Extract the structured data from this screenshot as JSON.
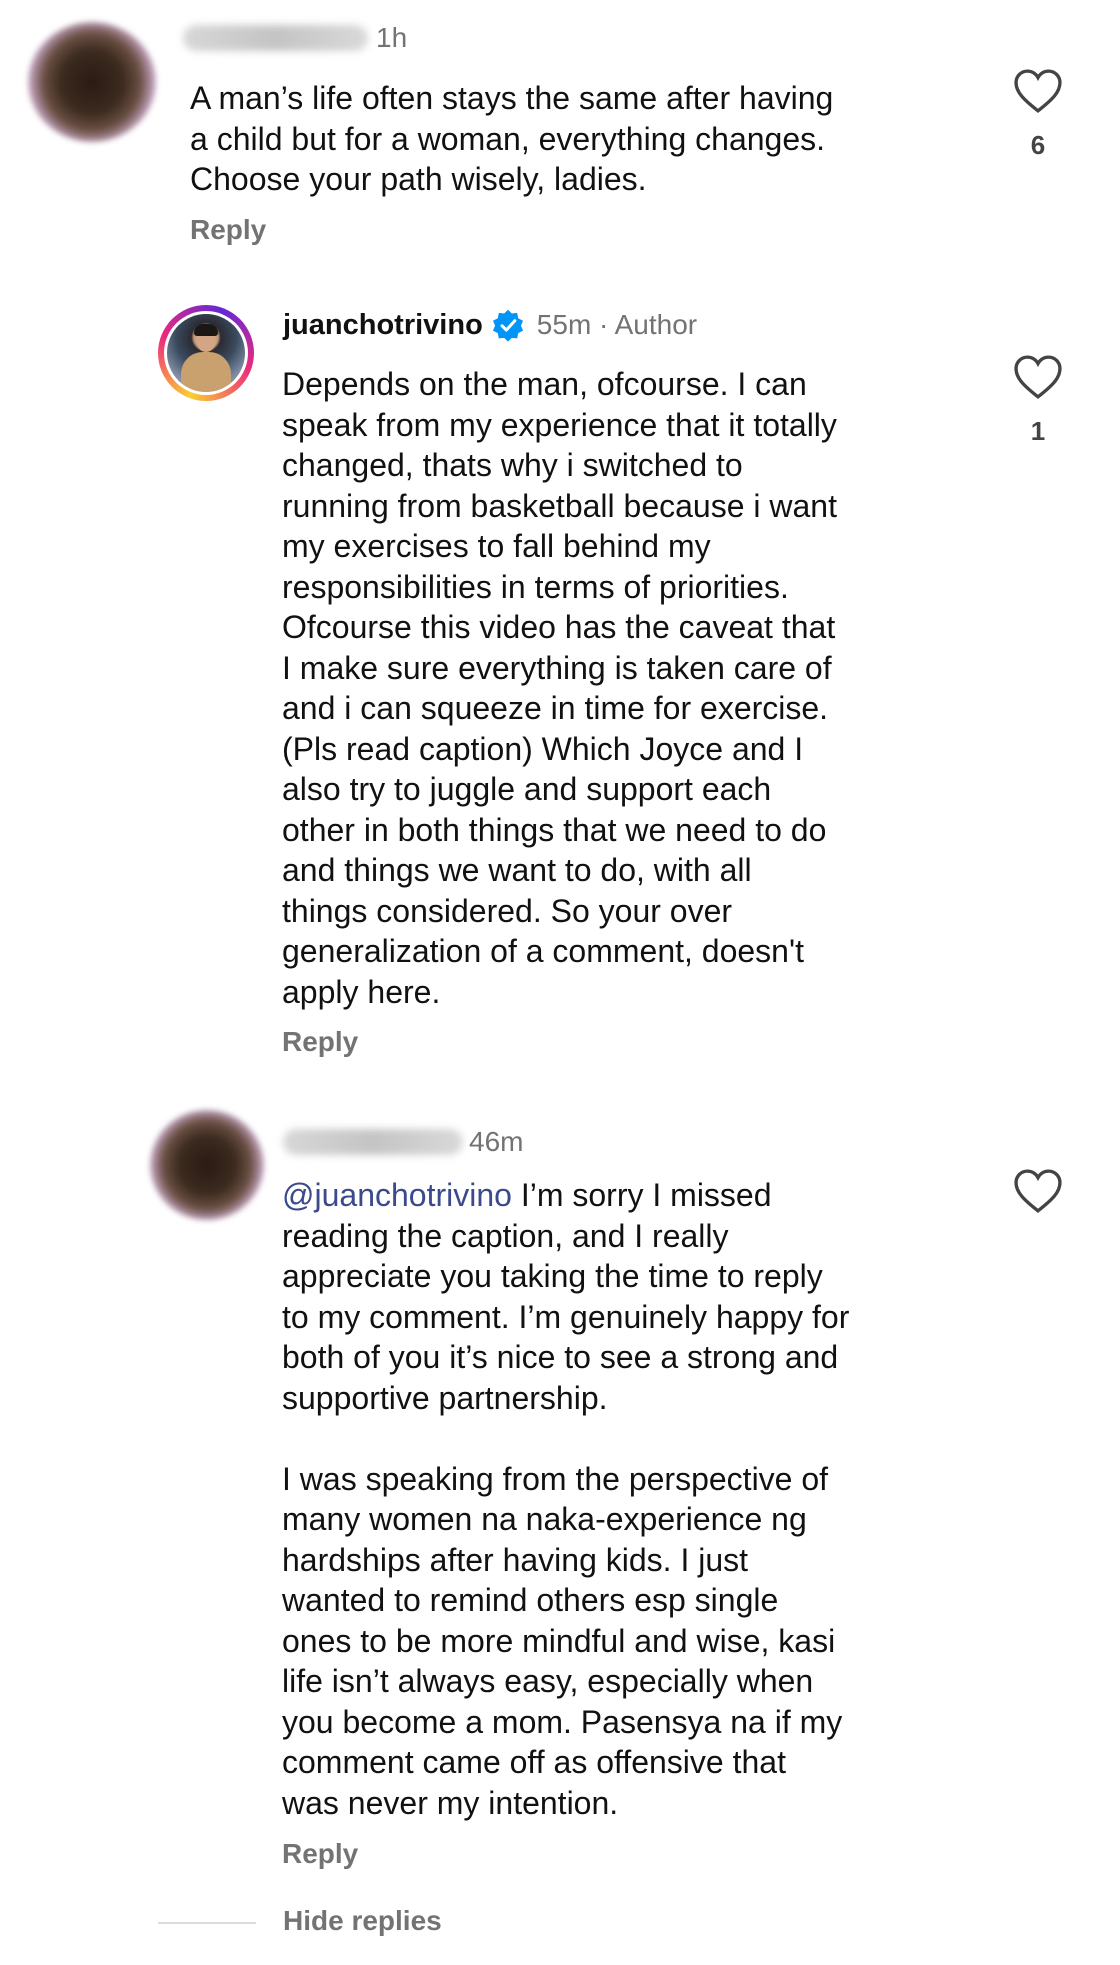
{
  "comments": [
    {
      "time": "1h",
      "text": "A man’s life often stays the same after having\na child but for a woman, everything changes.\nChoose your path wisely, ladies.",
      "reply_label": "Reply",
      "likes": "6",
      "icon": "heart-icon"
    },
    {
      "username": "juanchotrivino",
      "time": "55m · Author",
      "text": "Depends on the man, ofcourse. I can\nspeak from my experience that it totally\nchanged, thats why i switched to\nrunning from basketball because i want\nmy exercises to fall behind my\nresponsibilities in terms of priorities.\nOfcourse this video has the caveat that\nI make sure everything is taken care of\nand i can squeeze in time for exercise.\n(Pls read caption) Which Joyce and I\nalso try to juggle and support each\nother in both things that we need to do\nand things we want to do, with all\nthings considered. So your over\ngeneralization of a comment, doesn't\napply here.",
      "reply_label": "Reply",
      "likes": "1",
      "icon": "heart-icon",
      "verified_color": "#0095f6"
    },
    {
      "time": "46m",
      "mention": "@juanchotrivino",
      "text": " I’m sorry I missed\nreading the caption, and I really\nappreciate you taking the time to reply\nto my comment. I’m genuinely happy for\nboth of you it’s nice to see a strong and\nsupportive partnership.\n\nI was speaking from the perspective of\nmany women na naka-experience ng\nhardships after having kids. I just\nwanted to remind others esp single\nones to be more mindful and wise, kasi\nlife isn’t always easy, especially when\nyou become a mom. Pasensya na if my\ncomment came off as offensive that\nwas never my intention.",
      "reply_label": "Reply",
      "icon": "heart-icon"
    }
  ],
  "hide_replies": "Hide replies"
}
